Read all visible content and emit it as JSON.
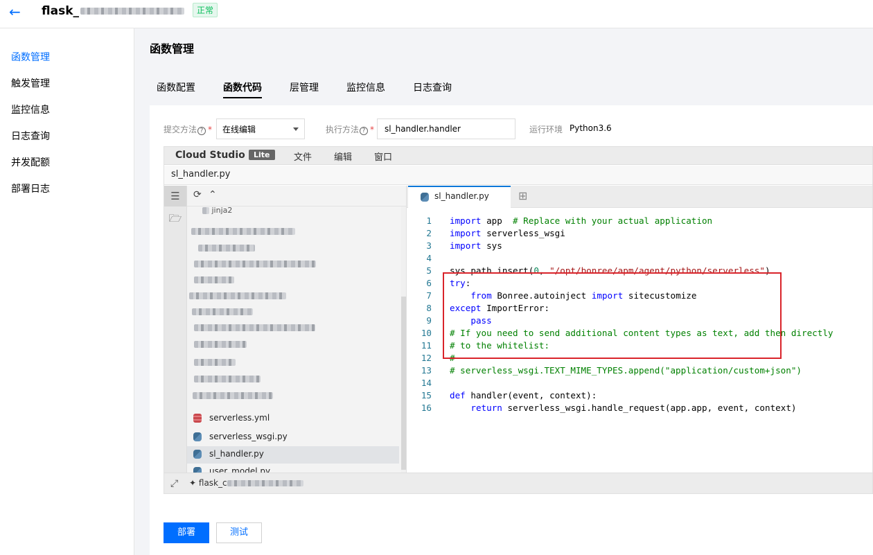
{
  "header": {
    "title": "flask_",
    "status": "正常"
  },
  "sidebar": {
    "items": [
      {
        "label": "函数管理",
        "active": true
      },
      {
        "label": "触发管理"
      },
      {
        "label": "监控信息"
      },
      {
        "label": "日志查询"
      },
      {
        "label": "并发配额"
      },
      {
        "label": "部署日志"
      }
    ]
  },
  "main": {
    "title": "函数管理",
    "tabs": [
      {
        "label": "函数配置"
      },
      {
        "label": "函数代码",
        "active": true
      },
      {
        "label": "层管理"
      },
      {
        "label": "监控信息"
      },
      {
        "label": "日志查询"
      }
    ]
  },
  "form": {
    "submit_label": "提交方法",
    "submit_value": "在线编辑",
    "handler_label": "执行方法",
    "handler_value": "sl_handler.handler",
    "runtime_label": "运行环境",
    "runtime_value": "Python3.6",
    "required_mark": "*",
    "help_mark": "?"
  },
  "ide": {
    "brand": "Cloud Studio",
    "badge": "Lite",
    "menu": [
      "文件",
      "编辑",
      "窗口"
    ],
    "path": "sl_handler.py",
    "explorer": {
      "partial_item": "jinja2",
      "files": [
        {
          "name": "serverless.yml",
          "icon": "yaml-file-icon"
        },
        {
          "name": "serverless_wsgi.py",
          "icon": "python-file-icon"
        },
        {
          "name": "sl_handler.py",
          "icon": "python-file-icon",
          "selected": true
        },
        {
          "name": "user_model.py",
          "icon": "python-file-icon"
        }
      ]
    },
    "editor_tab": "sl_handler.py",
    "code_lines": [
      {
        "n": "1",
        "segs": [
          [
            "kw",
            "import"
          ],
          [
            "",
            "app  "
          ],
          [
            "cm",
            "# Replace with your actual application"
          ]
        ]
      },
      {
        "n": "2",
        "segs": [
          [
            "kw",
            "import"
          ],
          [
            "",
            " serverless_wsgi"
          ]
        ]
      },
      {
        "n": "3",
        "segs": [
          [
            "kw",
            "import"
          ],
          [
            "",
            " sys"
          ]
        ]
      },
      {
        "n": "4",
        "segs": []
      },
      {
        "n": "5",
        "segs": [
          [
            "",
            "sys.path.insert("
          ],
          [
            "num",
            "0"
          ],
          [
            "",
            ", "
          ],
          [
            "str",
            "\"/opt/bonree/apm/agent/python/serverless\""
          ],
          [
            "",
            ")"
          ]
        ]
      },
      {
        "n": "6",
        "segs": [
          [
            "kw",
            "try"
          ],
          [
            "",
            ":"
          ]
        ]
      },
      {
        "n": "7",
        "segs": [
          [
            "",
            " "
          ],
          [
            "kw",
            "from"
          ],
          [
            "",
            " Bonree.autoinject "
          ],
          [
            "kw",
            "import"
          ],
          [
            "",
            " sitecustomize"
          ]
        ]
      },
      {
        "n": "8",
        "segs": [
          [
            "kw",
            "except"
          ],
          [
            "",
            " ImportError:"
          ]
        ]
      },
      {
        "n": "9",
        "segs": [
          [
            "",
            " "
          ],
          [
            "kw",
            "pass"
          ]
        ]
      },
      {
        "n": "10",
        "segs": [
          [
            "cm",
            "# If you need to send additional content types as text, add then directly"
          ]
        ]
      },
      {
        "n": "11",
        "segs": [
          [
            "cm",
            "# to the whitelist:"
          ]
        ]
      },
      {
        "n": "12",
        "segs": [
          [
            "cm",
            "#"
          ]
        ]
      },
      {
        "n": "13",
        "segs": [
          [
            "cm",
            "# serverless_wsgi.TEXT_MIME_TYPES.append(\"application/custom+json\")"
          ]
        ]
      },
      {
        "n": "14",
        "segs": []
      },
      {
        "n": "15",
        "segs": [
          [
            "kw",
            "def"
          ],
          [
            "",
            " handler(event, context):"
          ]
        ]
      },
      {
        "n": "16",
        "segs": [
          [
            "",
            " "
          ],
          [
            "kw",
            "return"
          ],
          [
            "",
            " serverless_wsgi.handle_request(app.app, event, context)"
          ]
        ]
      }
    ],
    "footer_project": "flask_c"
  },
  "buttons": {
    "deploy": "部署",
    "test": "测试"
  },
  "colors": {
    "primary": "#006eff",
    "status_green": "#0abf5b",
    "highlight_red": "#d9232a"
  }
}
